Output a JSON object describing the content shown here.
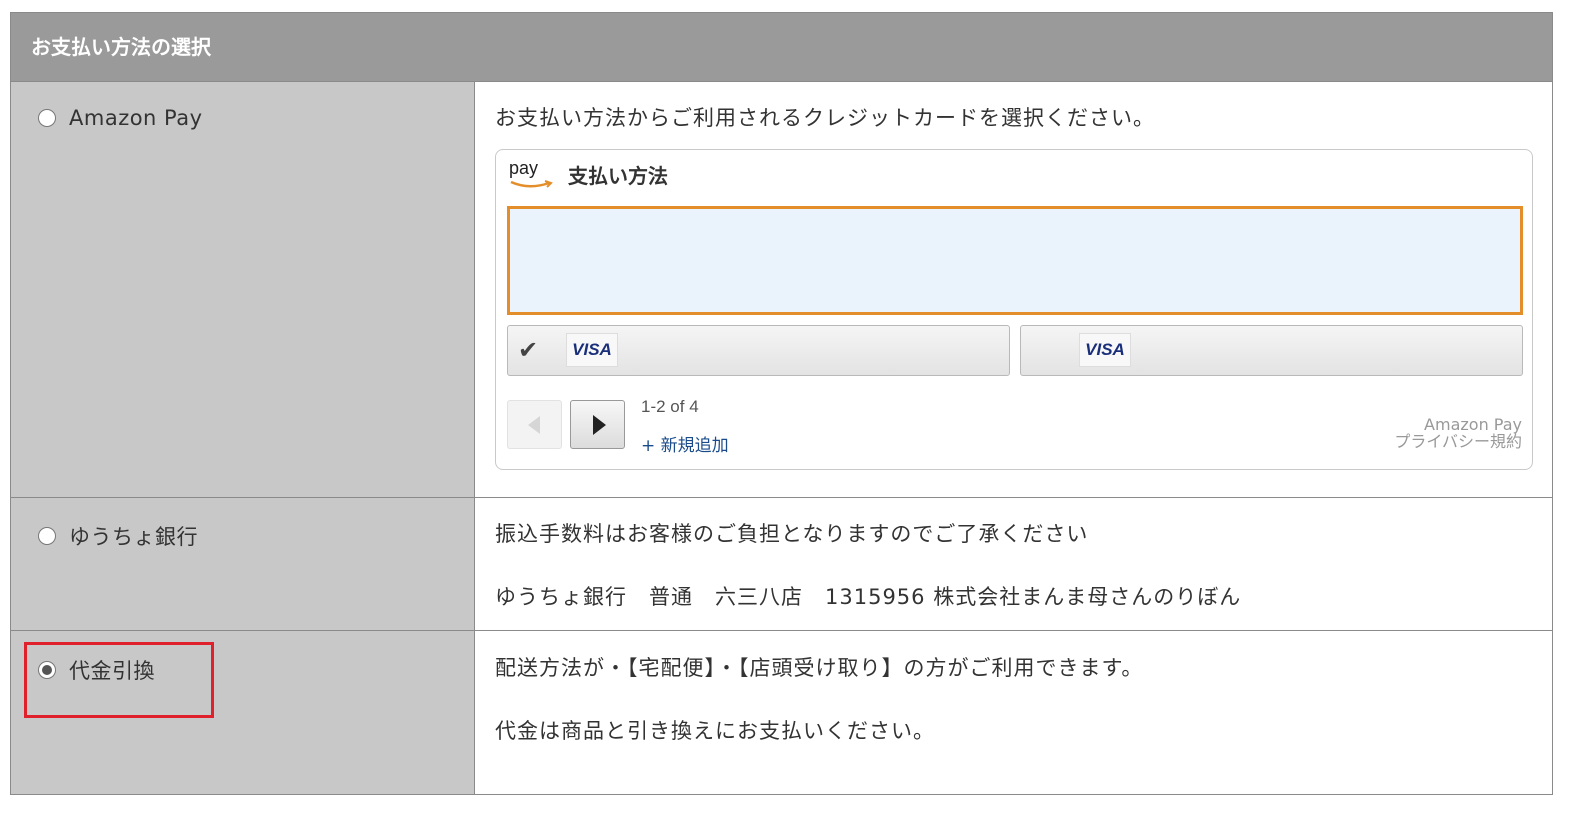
{
  "header": {
    "title": "お支払い方法の選択"
  },
  "options": [
    {
      "label": "Amazon Pay",
      "selected": false,
      "description": "お支払い方法からご利用されるクレジットカードを選択ください。",
      "widget": {
        "logo_text": "pay",
        "title": "支払い方法",
        "cards": [
          {
            "brand": "VISA",
            "checked": true,
            "check_icon": "✔"
          },
          {
            "brand": "VISA",
            "checked": false
          }
        ],
        "page_count": "1-2 of 4",
        "add_new": "+ 新規追加",
        "privacy_line1": "Amazon Pay",
        "privacy_line2": "プライバシー規約"
      }
    },
    {
      "label": "ゆうちょ銀行",
      "selected": false,
      "description_lines": [
        "振込手数料はお客様のご負担となりますのでご了承ください",
        "ゆうちょ銀行　普通　六三八店　1315956 株式会社まんま母さんのりぼん"
      ]
    },
    {
      "label": "代金引換",
      "selected": true,
      "description_lines": [
        "配送方法が・【宅配便】・【店頭受け取り】の方がご利用できます。",
        "代金は商品と引き換えにお支払いください。"
      ]
    }
  ],
  "colors": {
    "header_bg": "#9a9a9a",
    "left_column_bg": "#c8c8c8",
    "selection_border": "#e48e2b",
    "highlight_border": "#e0202a",
    "link": "#1a4c8c"
  }
}
